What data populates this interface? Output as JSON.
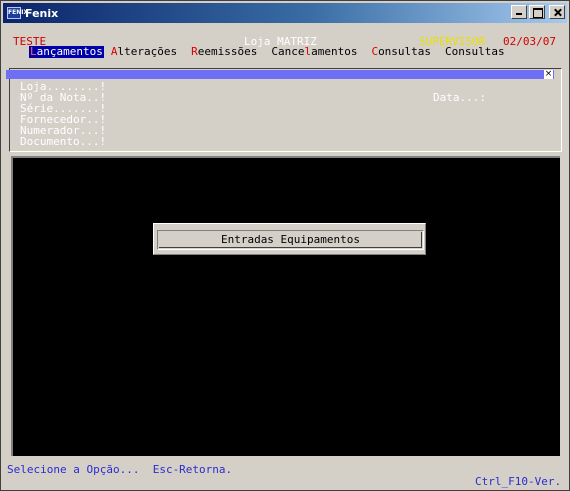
{
  "window": {
    "title": "Fenix",
    "icon_label": "FENIX"
  },
  "header": {
    "env": "TESTE",
    "store": "Loja MATRIZ",
    "user": "SUPERVISOR",
    "date": "02/03/07"
  },
  "menu": {
    "items": [
      {
        "hotkey": "L",
        "rest": "ançamentos",
        "active": true
      },
      {
        "hotkey": "A",
        "rest": "lterações"
      },
      {
        "hotkey": "R",
        "rest": "eemissões"
      },
      {
        "pre": "Cance",
        "hotkey": "l",
        "rest": "amentos"
      },
      {
        "hotkey": "C",
        "rest": "onsultas"
      },
      {
        "pre": "Consultas"
      }
    ]
  },
  "form": {
    "close_symbol": "×",
    "fields": [
      "Loja........!",
      "Nº da Nota..!",
      "Série.......!",
      "Fornecedor..!",
      "Numerador...!",
      "Documento...!"
    ],
    "date_label": "Data...:"
  },
  "dialog": {
    "option": "Entradas Equipamentos"
  },
  "status": {
    "hint": "Selecione a Opção...  Esc-Retorna.",
    "version": "Ctrl_F10-Ver."
  },
  "colors": {
    "menu_highlight": "#0000a8",
    "form_band": "#6f6ff5",
    "screen_bg": "#000000",
    "status_text": "#2b2bd0"
  }
}
